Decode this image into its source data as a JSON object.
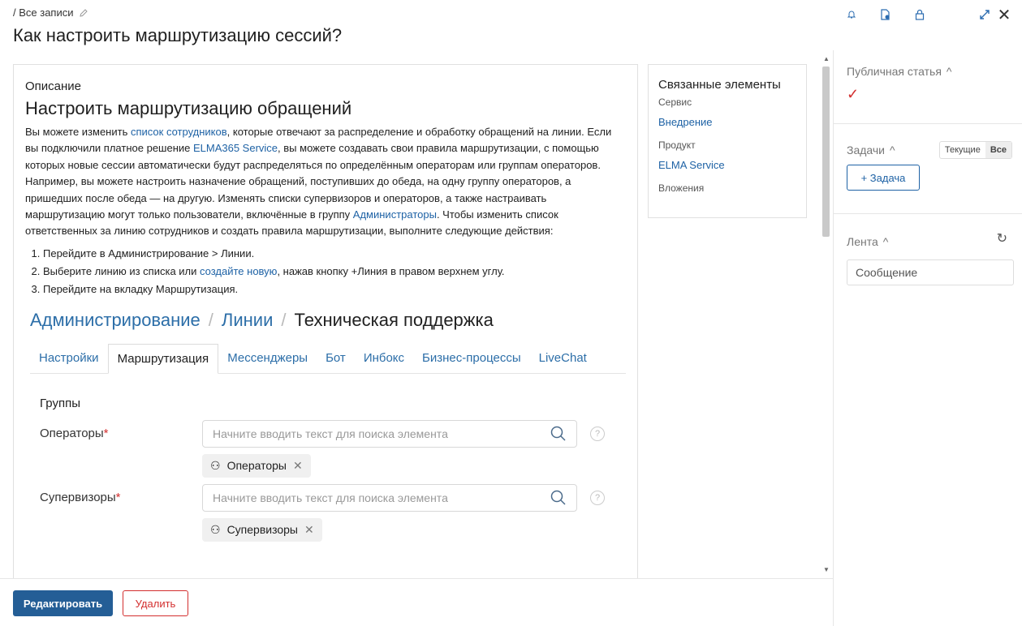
{
  "header": {
    "breadcrumb": "/ Все записи",
    "title": "Как настроить маршрутизацию сессий?"
  },
  "top_icons": [
    "bell-icon",
    "document-settings-icon",
    "lock-icon",
    "expand-icon",
    "close-icon"
  ],
  "description": {
    "label": "Описание",
    "heading": "Настроить маршрутизацию обращений",
    "p1_a": "Вы можете изменить ",
    "p1_link1": "список сотрудников",
    "p1_b": ", которые отвечают за распределение и обработку обращений на линии. Если вы подключили платное решение ",
    "p1_link2": "ELMA365 Service",
    "p1_c": ", вы можете создавать свои правила маршрутизации, с помощью которых новые сессии автоматически будут распределяться по определённым операторам или группам операторов. Например, вы можете настроить назначение обращений, поступивших до обеда, на одну группу операторов, а пришедших после обеда — на другую. Изменять списки супервизоров и операторов, а также настраивать маршрутизацию могут только пользователи, включённые в группу ",
    "p1_link3": "Администраторы",
    "p1_d": ". Чтобы изменить список ответственных за линию сотрудников и создать правила маршрутизации, выполните следующие действия:",
    "step1": "Перейдите в Администрирование > Линии.",
    "step2_a": "Выберите линию из списка или ",
    "step2_link": "создайте новую",
    "step2_b": ", нажав кнопку +Линия в правом верхнем углу.",
    "step3": "Перейдите на вкладку Маршрутизация."
  },
  "screenshot": {
    "bc1": "Администрирование",
    "bc_sep": "/",
    "bc2": "Линии",
    "bc3": "Техническая поддержка",
    "tabs": [
      "Настройки",
      "Маршрутизация",
      "Мессенджеры",
      "Бот",
      "Инбокс",
      "Бизнес-процессы",
      "LiveChat"
    ],
    "group_title": "Группы",
    "operators_label": "Операторы",
    "required": "*",
    "search_placeholder": "Начните вводить текст для поиска элемента",
    "operators_chip": "Операторы",
    "supervisors_label": "Супервизоры",
    "supervisors_chip": "Супервизоры"
  },
  "related": {
    "title": "Связанные элементы",
    "service_label": "Сервис",
    "service_value": "Внедрение",
    "product_label": "Продукт",
    "product_value": "ELMA Service",
    "attachments_label": "Вложения"
  },
  "side": {
    "public_label": "Публичная статья",
    "tasks_label": "Задачи",
    "toggle_current": "Текущие",
    "toggle_all": "Все",
    "add_task": "+ Задача",
    "feed_label": "Лента",
    "message_placeholder": "Сообщение"
  },
  "footer": {
    "edit": "Редактировать",
    "delete": "Удалить"
  }
}
